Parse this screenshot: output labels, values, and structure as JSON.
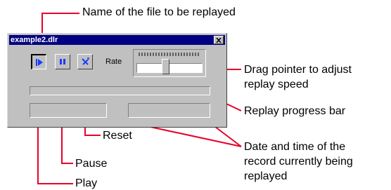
{
  "window": {
    "title": "example2.dlr"
  },
  "controls": {
    "rate_label": "Rate",
    "play_icon": "play-icon",
    "pause_icon": "pause-icon",
    "reset_icon": "reset-icon",
    "close_icon": "close-icon"
  },
  "callouts": {
    "file_name": "Name of the file to be replayed",
    "drag_pointer_line1": "Drag pointer to adjust",
    "drag_pointer_line2": "replay speed",
    "progress_bar": "Replay progress bar",
    "reset": "Reset",
    "pause": "Pause",
    "play": "Play",
    "date_time_line1": "Date and time of the",
    "date_time_line2": "record currently being",
    "date_time_line3": "replayed"
  },
  "colors": {
    "accent_red": "#e8002a",
    "titlebar": "#000080",
    "icon_blue": "#1a3cff"
  }
}
